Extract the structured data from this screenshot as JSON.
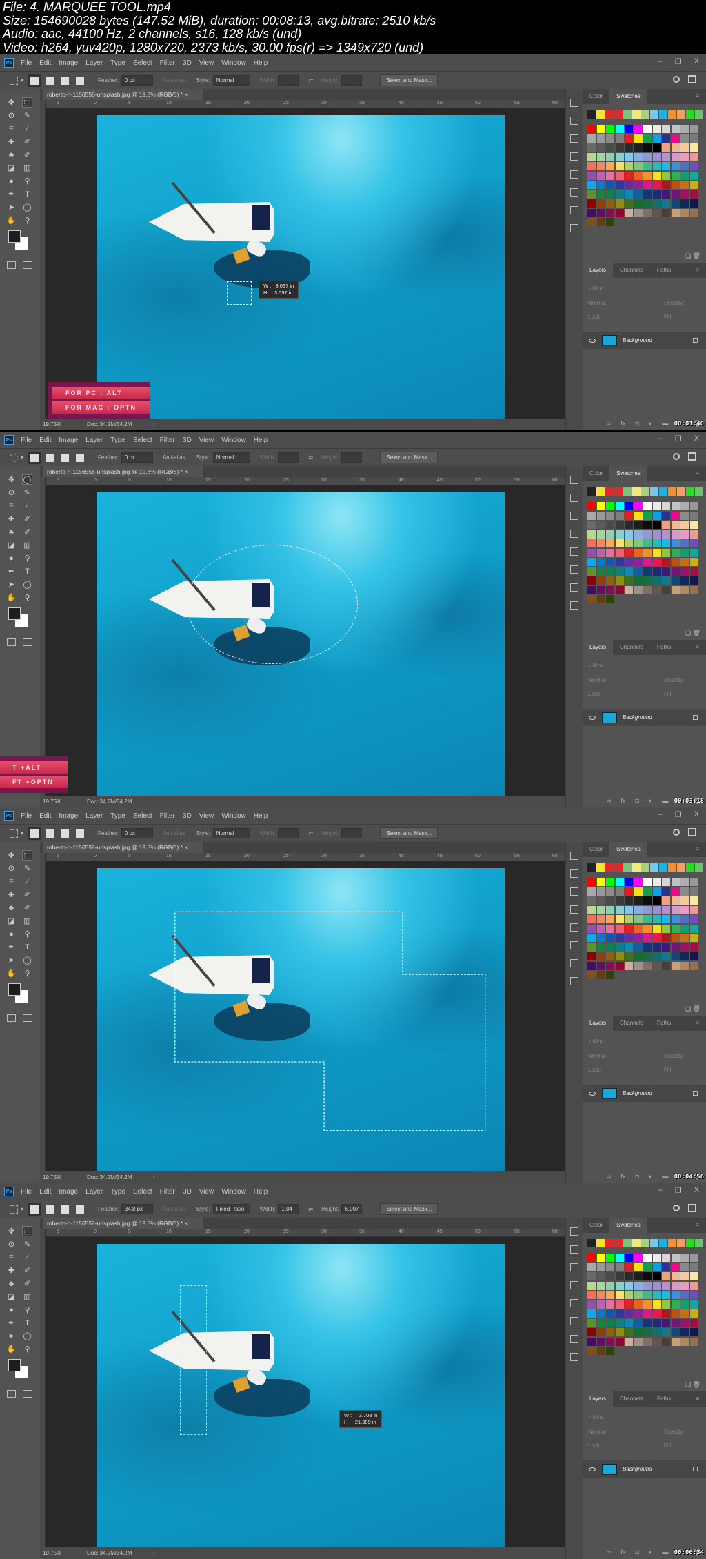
{
  "header": {
    "lines": [
      "File: 4. MARQUEE TOOL.mp4",
      "Size: 154690028 bytes (147.52 MiB), duration: 00:08:13, avg.bitrate: 2510 kb/s",
      "Audio: aac, 44100 Hz, 2 channels, s16, 128 kb/s (und)",
      "Video: h264, yuv420p, 1280x720, 2373 kb/s, 30.00 fps(r) => 1349x720 (und)"
    ]
  },
  "app": {
    "logo": "Ps",
    "menu": [
      "File",
      "Edit",
      "Image",
      "Layer",
      "Type",
      "Select",
      "Filter",
      "3D",
      "View",
      "Window",
      "Help"
    ],
    "window_controls": [
      "–",
      "❐",
      "X"
    ],
    "doc_tab": "roberto-h-1156558-unsplash.jpg @ 19.8% (RGB/8) *",
    "ruler_labels": [
      "5",
      "0",
      "5",
      "10",
      "15",
      "20",
      "25",
      "30",
      "35",
      "40",
      "45",
      "50",
      "55",
      "60"
    ],
    "labels": {
      "feather": "Feather:",
      "anti_alias": "Anti-alias",
      "style": "Style:",
      "width": "Width:",
      "height": "Height:",
      "select_mask": "Select and Mask..."
    },
    "status": {
      "zoom": "19.75%",
      "doc": "Doc: 34.2M/34.2M"
    },
    "panels": {
      "color_tab": "Color",
      "swatches_tab": "Swatches",
      "layers_tabs": [
        "Layers",
        "Channels",
        "Paths"
      ],
      "kind": "Kind",
      "blend": "Normal",
      "opacity": "Opacity:",
      "lock": "Lock:",
      "fill": "Fill:",
      "layer_name": "Background"
    },
    "tool_icons": [
      "move-icon",
      "rectangular-marquee-icon",
      "lasso-icon",
      "quick-selection-icon",
      "crop-icon",
      "eyedropper-icon",
      "healing-brush-icon",
      "brush-icon",
      "clone-stamp-icon",
      "history-brush-icon",
      "eraser-icon",
      "gradient-icon",
      "blur-icon",
      "dodge-icon",
      "pen-icon",
      "type-icon",
      "path-selection-icon",
      "ellipse-icon",
      "hand-icon",
      "zoom-icon",
      "more-tools-icon"
    ]
  },
  "swatches": {
    "recent": [
      "#222222",
      "#f5e52a",
      "#e8262a",
      "#e02a2e",
      "#7dc47a",
      "#f0ea78",
      "#a8d080",
      "#7ac8e8",
      "#20b0e0",
      "#f09030",
      "#f0a060",
      "#20e020",
      "#70c070"
    ],
    "grid": [
      "#ff0000",
      "#ffff00",
      "#00ff00",
      "#00ffff",
      "#0000ff",
      "#ff00ff",
      "#ffffff",
      "#ebebeb",
      "#d6d6d6",
      "#c2c2c2",
      "#adadad",
      "#999999",
      "#a8a8a8",
      "#9a9a9a",
      "#8c8c8c",
      "#7e7e7e",
      "#e02020",
      "#f8e010",
      "#10a050",
      "#10a0e0",
      "#303090",
      "#e0108a",
      "#8a8a8a",
      "#7a7a7a",
      "#6a6a6a",
      "#5a5a5a",
      "#4a4a4a",
      "#3a3a3a",
      "#2a2a2a",
      "#1e1e1e",
      "#0d0d0d",
      "#000000",
      "#f0a080",
      "#f4b890",
      "#f8c898",
      "#f8e8a0",
      "#b8d890",
      "#a0d8a0",
      "#90d0b0",
      "#88d0d0",
      "#80c8f0",
      "#88b0e8",
      "#9098d8",
      "#a090d0",
      "#b890d0",
      "#d898c8",
      "#f098c0",
      "#f09898",
      "#f07060",
      "#f08860",
      "#f8a860",
      "#f8e070",
      "#b0d070",
      "#80c880",
      "#40b890",
      "#30b8b8",
      "#20b8e8",
      "#4090d8",
      "#5070c8",
      "#7050b8",
      "#9050b0",
      "#c060b0",
      "#e870a0",
      "#f06070",
      "#e82020",
      "#f06020",
      "#f89020",
      "#f8e020",
      "#90c840",
      "#30b050",
      "#10a070",
      "#10a8a0",
      "#10a8e8",
      "#1078c8",
      "#1058b0",
      "#3038a0",
      "#6030a0",
      "#9020a0",
      "#e01890",
      "#e81850",
      "#b01818",
      "#c05010",
      "#c87010",
      "#c8b010",
      "#609030",
      "#208040",
      "#108050",
      "#108080",
      "#1088b8",
      "#1060a0",
      "#103878",
      "#202878",
      "#401878",
      "#701878",
      "#a01068",
      "#a01040",
      "#900000",
      "#904010",
      "#906010",
      "#909010",
      "#407020",
      "#107030",
      "#107040",
      "#107070",
      "#107890",
      "#104878",
      "#102860",
      "#101850",
      "#401060",
      "#601060",
      "#801050",
      "#900830",
      "#c8b0a0",
      "#a09088",
      "#807068",
      "#605850",
      "#484038",
      "#c8a078",
      "#b08860",
      "#987050",
      "#805020",
      "#604010",
      "#304010"
    ]
  },
  "frames": [
    {
      "timestamp": "00:01:40",
      "marquee": "rect",
      "feather": "0 px",
      "anti_alias_enabled": false,
      "style": "Normal",
      "width": "",
      "height": "",
      "selection": "small-rect",
      "tooltip": "W :   3.097 in\nH :   3.097 in",
      "banner": [
        "FOR PC : ALT",
        "FOR MAC : OPTN"
      ],
      "banner_pos": "left-canvas"
    },
    {
      "timestamp": "00:03:18",
      "marquee": "ellipse",
      "feather": "0 px",
      "anti_alias_enabled": true,
      "style": "Normal",
      "width": "",
      "height": "",
      "selection": "ellipse",
      "tooltip": "",
      "banner": [
        "T +ALT",
        "FT +OPTN"
      ],
      "banner_pos": "edge"
    },
    {
      "timestamp": "00:04:56",
      "marquee": "rect",
      "feather": "0 px",
      "anti_alias_enabled": false,
      "style": "Normal",
      "width": "",
      "height": "",
      "selection": "polygon",
      "tooltip": "",
      "banner": []
    },
    {
      "timestamp": "00:06:34",
      "marquee": "rect",
      "feather": "34.8 px",
      "anti_alias_enabled": false,
      "style": "Fixed Ratio",
      "width": "1.04",
      "height": "6.007",
      "selection": "tall-rect",
      "tooltip": "W :     3.708 in\nH :   21.389 in",
      "banner": []
    }
  ]
}
